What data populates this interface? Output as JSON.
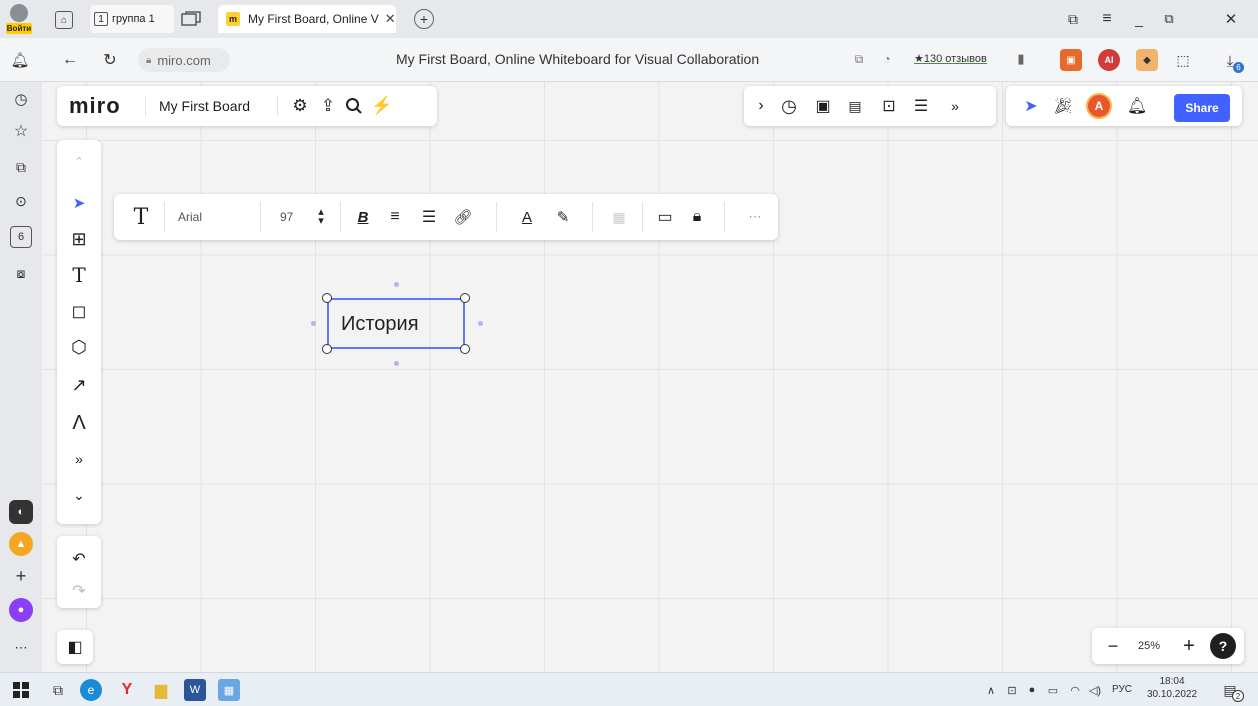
{
  "browser": {
    "login_label": "Войти",
    "group_tab_count": "1",
    "group_tab_label": "группа 1",
    "active_tab_title": "My First Board, Online V",
    "address_domain": "miro.com",
    "page_title": "My First Board, Online Whiteboard for Visual Collaboration",
    "reviews_label": "★130 отзывов",
    "ext_badge_count": "6"
  },
  "miro": {
    "logo": "miro",
    "board_name": "My First Board",
    "share_label": "Share",
    "avatar_letter": "A",
    "zoom_level": "25%",
    "help_label": "?",
    "text_toolbar": {
      "font_family": "Arial",
      "font_size": "97"
    },
    "canvas_text": "История"
  },
  "taskbar": {
    "language": "РУС",
    "time": "18:04",
    "date": "30.10.2022",
    "notification_count": "2"
  },
  "colors": {
    "accent": "#4262ff",
    "selection": "#4262ff",
    "avatar": "#e8562a"
  }
}
